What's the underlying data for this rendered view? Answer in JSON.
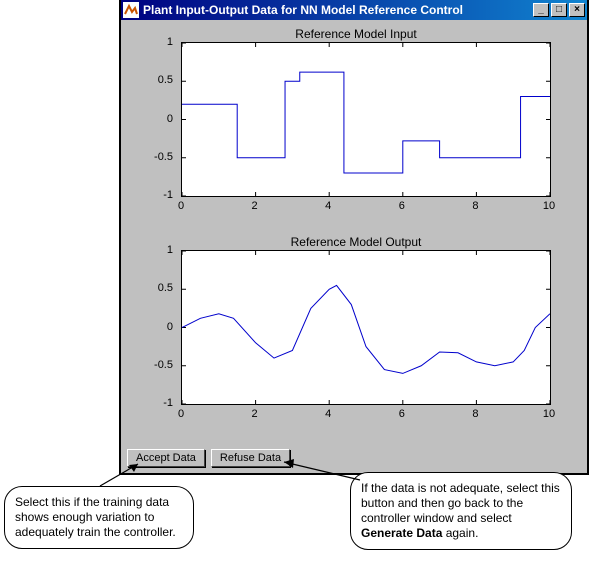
{
  "window_title": "Plant Input-Output Data for NN Model Reference Control",
  "chart_data": [
    {
      "type": "line",
      "title": "Reference Model Input",
      "xlabel": "",
      "ylabel": "",
      "xlim": [
        0,
        10
      ],
      "ylim": [
        -1,
        1
      ],
      "xticks": [
        0,
        2,
        4,
        6,
        8,
        10
      ],
      "yticks": [
        -1,
        -0.5,
        0,
        0.5,
        1
      ],
      "step_signal": true,
      "x": [
        0,
        1.5,
        2.8,
        3.2,
        4.4,
        6.0,
        7.0,
        9.2,
        10
      ],
      "y": [
        0.2,
        -0.5,
        0.5,
        0.62,
        -0.7,
        -0.28,
        -0.5,
        0.3,
        0.3
      ]
    },
    {
      "type": "line",
      "title": "Reference Model Output",
      "xlabel": "",
      "ylabel": "",
      "xlim": [
        0,
        10
      ],
      "ylim": [
        -1,
        1
      ],
      "xticks": [
        0,
        2,
        4,
        6,
        8,
        10
      ],
      "yticks": [
        -1,
        -0.5,
        0,
        0.5,
        1
      ],
      "x": [
        0,
        0.5,
        1.0,
        1.4,
        2.0,
        2.5,
        3.0,
        3.5,
        4.0,
        4.2,
        4.6,
        5.0,
        5.5,
        6.0,
        6.5,
        7.0,
        7.5,
        8.0,
        8.5,
        9.0,
        9.3,
        9.6,
        10.0
      ],
      "y": [
        0.0,
        0.12,
        0.18,
        0.12,
        -0.2,
        -0.4,
        -0.3,
        0.25,
        0.5,
        0.55,
        0.3,
        -0.25,
        -0.55,
        -0.6,
        -0.5,
        -0.32,
        -0.33,
        -0.45,
        -0.5,
        -0.45,
        -0.3,
        0.0,
        0.18
      ]
    }
  ],
  "buttons": {
    "accept": "Accept Data",
    "refuse": "Refuse Data"
  },
  "callouts": {
    "left": "Select this if the training data shows enough variation to adequately train the controller.",
    "right_pre": "If the data is not adequate, select this button and then go back to the controller window and select ",
    "right_bold": "Generate Data",
    "right_post": " again."
  }
}
